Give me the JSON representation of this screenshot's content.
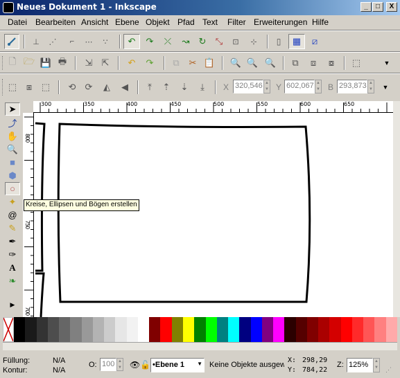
{
  "window": {
    "title": "Neues Dokument 1 - Inkscape",
    "minimize_label": "_",
    "maximize_label": "□",
    "close_label": "X"
  },
  "menu": [
    "Datei",
    "Bearbeiten",
    "Ansicht",
    "Ebene",
    "Objekt",
    "Pfad",
    "Text",
    "Filter",
    "Erweiterungen",
    "Hilfe"
  ],
  "coords": {
    "x_label": "X",
    "x_value": "320,546",
    "y_label": "Y",
    "y_value": "602,067",
    "b_label": "B",
    "b_value": "293,873"
  },
  "rulers": {
    "h_ticks": [
      "300",
      "350",
      "400",
      "450",
      "500",
      "550",
      "600",
      "650"
    ],
    "v_ticks": [
      "800",
      "750",
      "700"
    ]
  },
  "tooltip": "Kreise, Ellipsen und Bögen erstellen",
  "palette": {
    "grays": [
      "#000000",
      "#1a1a1a",
      "#333333",
      "#4d4d4d",
      "#666666",
      "#808080",
      "#999999",
      "#b3b3b3",
      "#cccccc",
      "#e6e6e6",
      "#f2f2f2",
      "#ffffff"
    ],
    "colors": [
      "#800000",
      "#ff0000",
      "#808000",
      "#ffff00",
      "#008000",
      "#00ff00",
      "#008080",
      "#00ffff",
      "#000080",
      "#0000ff",
      "#800080",
      "#ff00ff",
      "#2b0000",
      "#550000",
      "#800000",
      "#aa0000",
      "#d40000",
      "#ff0000",
      "#ff2a2a",
      "#ff5555",
      "#ff8080",
      "#ffaaaa"
    ]
  },
  "status": {
    "fill_label": "Füllung:",
    "fill_value": "N/A",
    "stroke_label": "Kontur:",
    "stroke_value": "N/A",
    "opacity_label": "O:",
    "opacity_value": "100",
    "layer_value": "•Ebene 1",
    "message": "Keine Objekte ausgew",
    "cursor_x_label": "X:",
    "cursor_x": "298,29",
    "cursor_y_label": "Y:",
    "cursor_y": "784,22",
    "zoom_label": "Z:",
    "zoom_value": "125%"
  }
}
